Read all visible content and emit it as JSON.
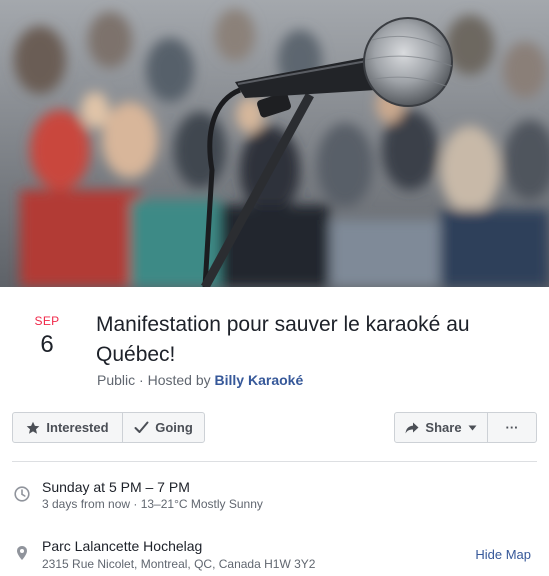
{
  "event": {
    "date": {
      "month": "SEP",
      "day": "6"
    },
    "title": "Manifestation pour sauver le karaoké au Québec!",
    "privacy": "Public",
    "hosted_by_prefix": " · Hosted by ",
    "host": "Billy Karaoké"
  },
  "actions": {
    "interested_label": "Interested",
    "going_label": "Going",
    "share_label": "Share",
    "more_label": "···"
  },
  "details": {
    "time_main": "Sunday at 5 PM – 7 PM",
    "time_sub": "3 days from now · 13–21°C Mostly Sunny",
    "place_main": "Parc Lalancette Hochelag",
    "place_sub": "2315 Rue Nicolet, Montreal, QC, Canada H1W 3Y2",
    "hide_map_label": "Hide Map"
  },
  "colors": {
    "month_red": "#f02849",
    "link_blue": "#365899",
    "button_bg": "#f5f6f7"
  },
  "icons": [
    "star-icon",
    "checkmark-icon",
    "share-arrow-icon",
    "caret-down-icon",
    "clock-icon",
    "map-pin-icon"
  ]
}
